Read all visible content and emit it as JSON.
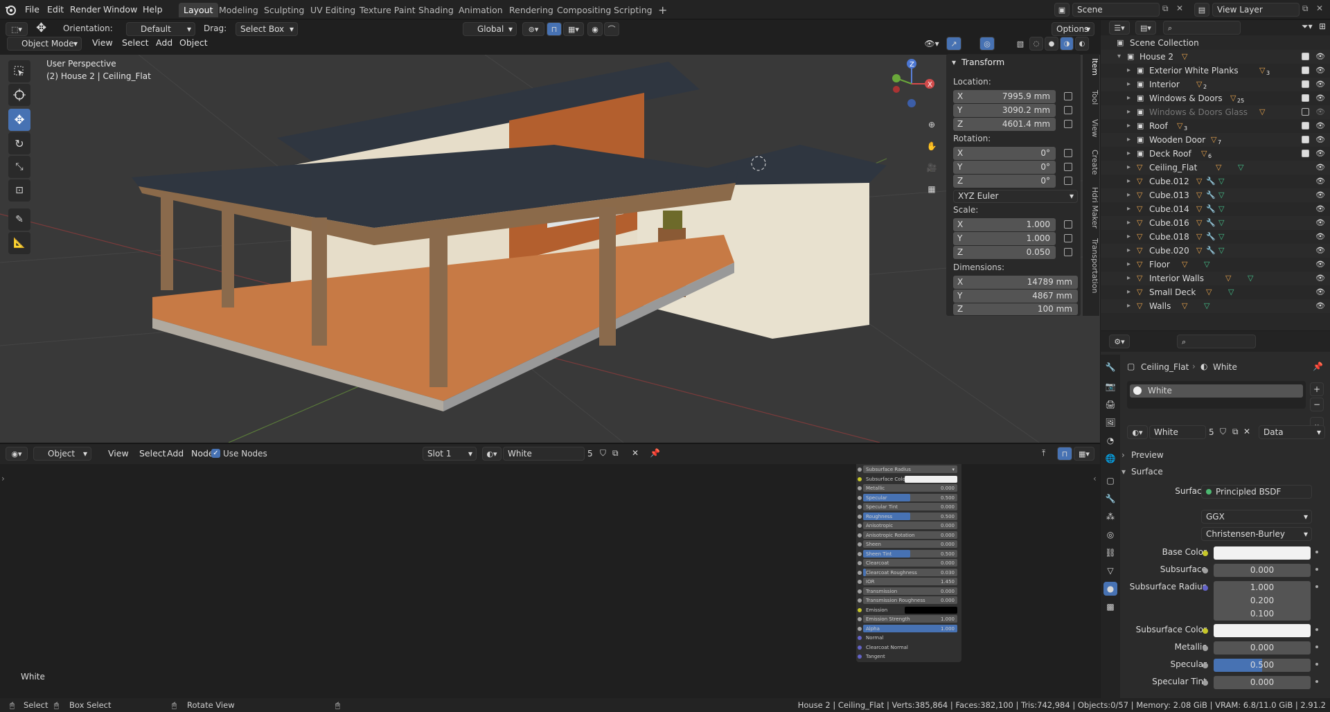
{
  "topbar": {
    "menus": [
      "File",
      "Edit",
      "Render",
      "Window",
      "Help"
    ],
    "workspaces": [
      "Layout",
      "Modeling",
      "Sculpting",
      "UV Editing",
      "Texture Paint",
      "Shading",
      "Animation",
      "Rendering",
      "Compositing",
      "Scripting"
    ],
    "active_workspace": "Layout",
    "scene": "Scene",
    "view_layer": "View Layer"
  },
  "viewport_header": {
    "orientation_label": "Orientation:",
    "orientation": "Default",
    "drag_label": "Drag:",
    "drag": "Select Box",
    "transform_orientation": "Global",
    "options": "Options",
    "mode": "Object Mode",
    "menus": [
      "View",
      "Select",
      "Add",
      "Object"
    ]
  },
  "viewport": {
    "perspective": "User Perspective",
    "object_info": "(2) House 2 | Ceiling_Flat"
  },
  "npanel": {
    "section": "Transform",
    "location_label": "Location:",
    "location": [
      {
        "axis": "X",
        "value": "7995.9 mm"
      },
      {
        "axis": "Y",
        "value": "3090.2 mm"
      },
      {
        "axis": "Z",
        "value": "4601.4 mm"
      }
    ],
    "rotation_label": "Rotation:",
    "rotation": [
      {
        "axis": "X",
        "value": "0°"
      },
      {
        "axis": "Y",
        "value": "0°"
      },
      {
        "axis": "Z",
        "value": "0°"
      }
    ],
    "rotation_mode": "XYZ Euler",
    "scale_label": "Scale:",
    "scale": [
      {
        "axis": "X",
        "value": "1.000"
      },
      {
        "axis": "Y",
        "value": "1.000"
      },
      {
        "axis": "Z",
        "value": "0.050"
      }
    ],
    "dimensions_label": "Dimensions:",
    "dimensions": [
      {
        "axis": "X",
        "value": "14789 mm"
      },
      {
        "axis": "Y",
        "value": "4867 mm"
      },
      {
        "axis": "Z",
        "value": "100 mm"
      }
    ],
    "tabs": [
      "Item",
      "Tool",
      "View",
      "Create",
      "Hdri Maker",
      "Transportation"
    ]
  },
  "node_header": {
    "editor": "Object",
    "menus": [
      "View",
      "Select",
      "Add",
      "Node"
    ],
    "use_nodes": "Use Nodes",
    "slot": "Slot 1",
    "material": "White",
    "users": "5"
  },
  "node_editor": {
    "material_label": "White"
  },
  "node_rows": [
    {
      "label": "Subsurface Radius",
      "value": "",
      "type": "dropdown"
    },
    {
      "label": "Subsurface Color",
      "value": "",
      "type": "color",
      "color": "#f0f0f0"
    },
    {
      "label": "Metallic",
      "value": "0.000",
      "fill": 0
    },
    {
      "label": "Specular",
      "value": "0.500",
      "fill": 0.5
    },
    {
      "label": "Specular Tint",
      "value": "0.000",
      "fill": 0
    },
    {
      "label": "Roughness",
      "value": "0.500",
      "fill": 0.5
    },
    {
      "label": "Anisotropic",
      "value": "0.000",
      "fill": 0
    },
    {
      "label": "Anisotropic Rotation",
      "value": "0.000",
      "fill": 0
    },
    {
      "label": "Sheen",
      "value": "0.000",
      "fill": 0
    },
    {
      "label": "Sheen Tint",
      "value": "0.500",
      "fill": 0.5
    },
    {
      "label": "Clearcoat",
      "value": "0.000",
      "fill": 0
    },
    {
      "label": "Clearcoat Roughness",
      "value": "0.030",
      "fill": 0.03
    },
    {
      "label": "IOR",
      "value": "1.450",
      "fill": 0
    },
    {
      "label": "Transmission",
      "value": "0.000",
      "fill": 0
    },
    {
      "label": "Transmission Roughness",
      "value": "0.000",
      "fill": 0
    },
    {
      "label": "Emission",
      "value": "",
      "type": "color",
      "color": "#000000"
    },
    {
      "label": "Emission Strength",
      "value": "1.000",
      "fill": 0
    },
    {
      "label": "Alpha",
      "value": "1.000",
      "fill": 1
    },
    {
      "label": "Normal",
      "value": "",
      "type": "plain"
    },
    {
      "label": "Clearcoat Normal",
      "value": "",
      "type": "plain"
    },
    {
      "label": "Tangent",
      "value": "",
      "type": "plain"
    }
  ],
  "outliner": {
    "root": "Scene Collection",
    "items": [
      {
        "name": "House 2",
        "level": 1,
        "kind": "collection",
        "badge": ""
      },
      {
        "name": "Exterior White Planks",
        "level": 2,
        "kind": "collection",
        "badge": "3"
      },
      {
        "name": "Interior",
        "level": 2,
        "kind": "collection",
        "badge": "2"
      },
      {
        "name": "Windows & Doors",
        "level": 2,
        "kind": "collection",
        "badge": "25"
      },
      {
        "name": "Windows & Doors Glass",
        "level": 2,
        "kind": "collection",
        "badge": "",
        "dim": true
      },
      {
        "name": "Roof",
        "level": 2,
        "kind": "collection",
        "badge": "3"
      },
      {
        "name": "Wooden Door",
        "level": 2,
        "kind": "collection",
        "badge": "7"
      },
      {
        "name": "Deck Roof",
        "level": 2,
        "kind": "collection",
        "badge": "6"
      },
      {
        "name": "Ceiling_Flat",
        "level": 2,
        "kind": "mesh",
        "badge": ""
      },
      {
        "name": "Cube.012",
        "level": 2,
        "kind": "mesh",
        "badge": ""
      },
      {
        "name": "Cube.013",
        "level": 2,
        "kind": "mesh",
        "badge": ""
      },
      {
        "name": "Cube.014",
        "level": 2,
        "kind": "mesh",
        "badge": ""
      },
      {
        "name": "Cube.016",
        "level": 2,
        "kind": "mesh",
        "badge": ""
      },
      {
        "name": "Cube.018",
        "level": 2,
        "kind": "mesh",
        "badge": ""
      },
      {
        "name": "Cube.020",
        "level": 2,
        "kind": "mesh",
        "badge": ""
      },
      {
        "name": "Floor",
        "level": 2,
        "kind": "mesh",
        "badge": ""
      },
      {
        "name": "Interior Walls",
        "level": 2,
        "kind": "mesh",
        "badge": ""
      },
      {
        "name": "Small Deck",
        "level": 2,
        "kind": "mesh",
        "badge": ""
      },
      {
        "name": "Walls",
        "level": 2,
        "kind": "mesh",
        "badge": ""
      }
    ]
  },
  "properties": {
    "breadcrumb_object": "Ceiling_Flat",
    "breadcrumb_material": "White",
    "slot_name": "White",
    "material_name": "White",
    "users": "5",
    "link": "Data",
    "preview": "Preview",
    "surface_section": "Surface",
    "surface_label": "Surface",
    "surface_value": "Principled BSDF",
    "distribution": "GGX",
    "subsurface_method": "Christensen-Burley",
    "rows": [
      {
        "label": "Base Color",
        "kind": "color",
        "color": "#f2f2f2",
        "dot": "#c7c729"
      },
      {
        "label": "Subsurface",
        "kind": "value",
        "value": "0.000",
        "dot": "#a1a1a1"
      },
      {
        "label": "Subsurface Radius",
        "kind": "vector",
        "values": [
          "1.000",
          "0.200",
          "0.100"
        ],
        "dot": "#6363c7"
      },
      {
        "label": "Subsurface Color",
        "kind": "color",
        "color": "#f2f2f2",
        "dot": "#c7c729"
      },
      {
        "label": "Metallic",
        "kind": "value",
        "value": "0.000",
        "dot": "#a1a1a1"
      },
      {
        "label": "Specular",
        "kind": "value",
        "value": "0.500",
        "fill": 0.5,
        "dot": "#a1a1a1"
      },
      {
        "label": "Specular Tint",
        "kind": "value",
        "value": "0.000",
        "dot": "#a1a1a1"
      }
    ]
  },
  "statusbar": {
    "select": "Select",
    "box_select": "Box Select",
    "rotate_view": "Rotate View",
    "stats": "House 2 | Ceiling_Flat | Verts:385,864 | Faces:382,100 | Tris:742,984 | Objects:0/57 | Memory: 2.08 GiB | VRAM: 6.8/11.0 GiB | 2.91.2"
  },
  "colors": {
    "accent": "#4772b3",
    "collection": "#e8a34c",
    "mesh": "#44c08a",
    "wood": "#a8683c",
    "deck": "#c77a45",
    "roof": "#2f3640",
    "siding": "#e6ddc9"
  }
}
